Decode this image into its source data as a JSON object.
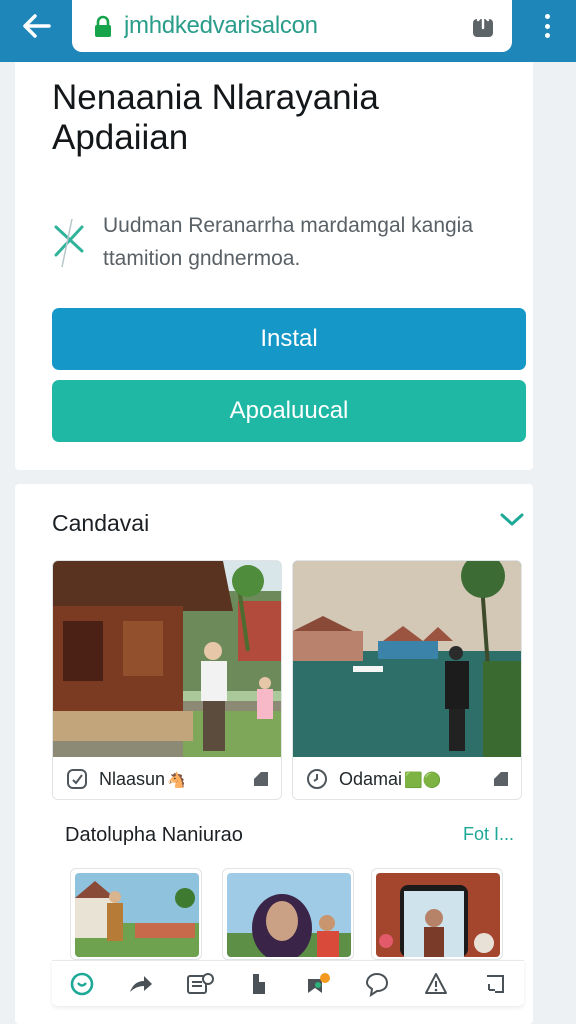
{
  "browser": {
    "url": "jmhdkedvarisalcon"
  },
  "app": {
    "title": "Nenaania Nlarayania Apdaiian",
    "description": "Uudman Reranarrha mardamgal kangia ttamition gndnermoa.",
    "install_label": "Instal",
    "app_label": "Apoaluucal"
  },
  "section": {
    "title": "Candavai"
  },
  "photos": [
    {
      "label": "Nlaasun",
      "emoji": "🐴"
    },
    {
      "label": "Odamai",
      "emoji": "🟩🟢"
    }
  ],
  "subsection": {
    "title": "Datolupha Naniurao",
    "link": "Fot I..."
  },
  "toolbar": {
    "items": [
      "home-icon",
      "share-icon",
      "media-icon",
      "bookmark-icon",
      "map-pin-icon",
      "chat-icon",
      "alert-icon",
      "expand-icon"
    ]
  },
  "colors": {
    "topbar": "#1e86b8",
    "install": "#1598c8",
    "app_button": "#1fb8a4",
    "accent": "#1ea898"
  }
}
